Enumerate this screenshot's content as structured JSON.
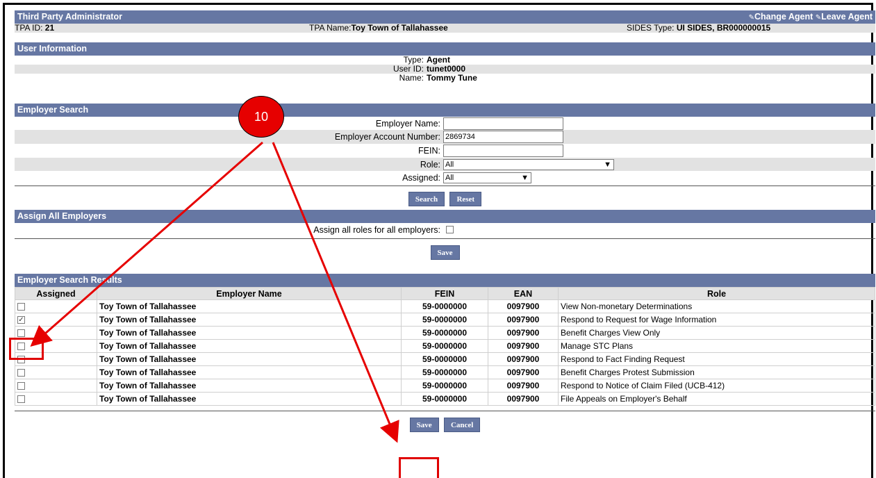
{
  "header": {
    "title": "Third Party Administrator",
    "change_agent": "Change Agent",
    "leave_agent": "Leave Agent",
    "tpa_id_label": "TPA ID: ",
    "tpa_id": "21",
    "tpa_name_label": "TPA Name:",
    "tpa_name": "Toy Town of Tallahassee",
    "sides_label": "SIDES Type: ",
    "sides_value": "UI SIDES, BR000000015"
  },
  "user_info": {
    "title": "User Information",
    "type_label": "Type:",
    "type_value": "Agent",
    "user_id_label": "User ID:",
    "user_id_value": "tunet0000",
    "name_label": "Name:",
    "name_value": "Tommy Tune"
  },
  "employer_search": {
    "title": "Employer Search",
    "employer_name_label": "Employer Name:",
    "employer_name_value": "",
    "account_number_label": "Employer Account Number:",
    "account_number_value": "2869734",
    "fein_label": "FEIN:",
    "fein_value": "",
    "role_label": "Role:",
    "role_value": "All",
    "assigned_label": "Assigned:",
    "assigned_value": "All",
    "search_button": "Search",
    "reset_button": "Reset"
  },
  "assign_all": {
    "title": "Assign All Employers",
    "label": "Assign all roles for all employers:",
    "save_button": "Save"
  },
  "results": {
    "title": "Employer Search Results",
    "columns": [
      "Assigned",
      "Employer Name",
      "FEIN",
      "EAN",
      "Role"
    ],
    "rows": [
      {
        "checked": false,
        "name": "Toy Town of Tallahassee",
        "fein": "59-0000000",
        "ean": "0097900",
        "role": "View Non-monetary Determinations"
      },
      {
        "checked": true,
        "name": "Toy Town of Tallahassee",
        "fein": "59-0000000",
        "ean": "0097900",
        "role": "Respond to Request for Wage Information"
      },
      {
        "checked": false,
        "name": "Toy Town of Tallahassee",
        "fein": "59-0000000",
        "ean": "0097900",
        "role": "Benefit Charges View Only"
      },
      {
        "checked": false,
        "name": "Toy Town of Tallahassee",
        "fein": "59-0000000",
        "ean": "0097900",
        "role": "Manage STC Plans"
      },
      {
        "checked": false,
        "name": "Toy Town of Tallahassee",
        "fein": "59-0000000",
        "ean": "0097900",
        "role": "Respond to Fact Finding Request"
      },
      {
        "checked": false,
        "name": "Toy Town of Tallahassee",
        "fein": "59-0000000",
        "ean": "0097900",
        "role": "Benefit Charges Protest Submission"
      },
      {
        "checked": false,
        "name": "Toy Town of Tallahassee",
        "fein": "59-0000000",
        "ean": "0097900",
        "role": "Respond to Notice of Claim Filed (UCB-412)"
      },
      {
        "checked": false,
        "name": "Toy Town of Tallahassee",
        "fein": "59-0000000",
        "ean": "0097900",
        "role": "File Appeals on Employer's Behalf"
      }
    ],
    "save_button": "Save",
    "cancel_button": "Cancel"
  },
  "annotation": {
    "step_number": "10",
    "color": "#e60000"
  }
}
